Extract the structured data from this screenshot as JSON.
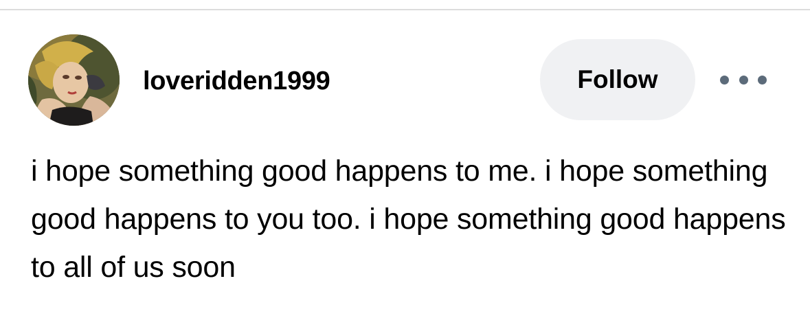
{
  "post": {
    "username": "loveridden1999",
    "follow_label": "Follow",
    "more_icon": "more-horizontal-icon",
    "body_text": "i hope something good happens to me. i hope something good happens to you too. i hope something good happens to all of us soon"
  },
  "colors": {
    "background": "#ffffff",
    "text": "#000000",
    "follow_bg": "#f0f1f3",
    "more_dots": "#5c6b7a",
    "divider": "#dcdcdc"
  }
}
